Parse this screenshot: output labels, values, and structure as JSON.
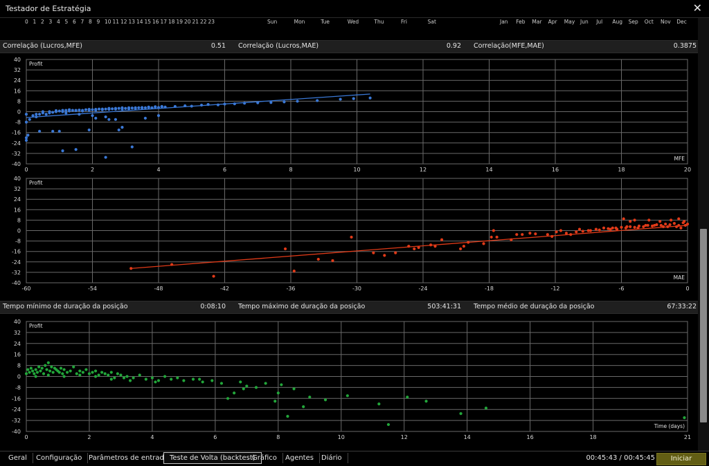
{
  "window": {
    "title": "Testador de Estratégia"
  },
  "hours": [
    "0",
    "1",
    "2",
    "3",
    "4",
    "5",
    "6",
    "7",
    "8",
    "9",
    "10",
    "11",
    "12",
    "13",
    "14",
    "15",
    "16",
    "17",
    "18",
    "19",
    "20",
    "21",
    "22",
    "23"
  ],
  "weekdays": [
    "Sun",
    "Mon",
    "Tue",
    "Wed",
    "Thu",
    "Fri",
    "Sat"
  ],
  "months": [
    "Jan",
    "Feb",
    "Mar",
    "Apr",
    "May",
    "Jun",
    "Jul",
    "Aug",
    "Sep",
    "Oct",
    "Nov",
    "Dec"
  ],
  "correlations": [
    {
      "label": "Correlação (Lucros,MFE)",
      "value": "0.51"
    },
    {
      "label": "Correlação (Lucros,MAE)",
      "value": "0.92"
    },
    {
      "label": "Correlação(MFE,MAE)",
      "value": "0.3875"
    }
  ],
  "durations": [
    {
      "label": "Tempo mínimo de duração da posição",
      "value": "0:08:10"
    },
    {
      "label": "Tempo máximo de duração da posição",
      "value": "503:41:31"
    },
    {
      "label": "Tempo médio de duração da posição",
      "value": "67:33:22"
    }
  ],
  "chart_data": [
    {
      "type": "scatter",
      "ylabel": "Profit",
      "xlabel": "MFE",
      "xlim": [
        0,
        20
      ],
      "ylim": [
        -40,
        40
      ],
      "xticks": [
        0,
        2,
        4,
        6,
        8,
        10,
        12,
        14,
        16,
        18,
        20
      ],
      "yticks": [
        40,
        32,
        24,
        16,
        8,
        0,
        -8,
        -16,
        -24,
        -32,
        -40
      ],
      "grid": true,
      "color": "#3a78d6",
      "trend": [
        [
          0,
          -4.5
        ],
        [
          10.4,
          13.5
        ]
      ],
      "points": [
        [
          0,
          -22
        ],
        [
          0,
          -20
        ],
        [
          0.05,
          -18
        ],
        [
          0,
          -8
        ],
        [
          0.1,
          -6
        ],
        [
          0,
          -2
        ],
        [
          0.2,
          -3
        ],
        [
          0.3,
          -4
        ],
        [
          0.4,
          -2
        ],
        [
          0.5,
          -1
        ],
        [
          0.6,
          -2
        ],
        [
          0.7,
          -1
        ],
        [
          0.8,
          -0.5
        ],
        [
          0.9,
          0
        ],
        [
          1,
          0.5
        ],
        [
          1.1,
          0
        ],
        [
          1.2,
          1
        ],
        [
          1.3,
          0.5
        ],
        [
          1.4,
          1
        ],
        [
          1.5,
          0.8
        ],
        [
          1.6,
          1.2
        ],
        [
          1.7,
          0.5
        ],
        [
          1.8,
          1.5
        ],
        [
          1.9,
          1
        ],
        [
          2,
          1.5
        ],
        [
          2.1,
          1
        ],
        [
          2.2,
          2
        ],
        [
          2.3,
          1.5
        ],
        [
          2.4,
          2
        ],
        [
          2.5,
          1.8
        ],
        [
          2.6,
          2.2
        ],
        [
          2.7,
          2
        ],
        [
          2.8,
          2.5
        ],
        [
          2.9,
          2
        ],
        [
          3,
          2.5
        ],
        [
          3.1,
          2.2
        ],
        [
          3.2,
          2.8
        ],
        [
          3.3,
          2.5
        ],
        [
          3.4,
          3
        ],
        [
          3.5,
          2.8
        ],
        [
          3.6,
          3
        ],
        [
          3.7,
          3.2
        ],
        [
          3.8,
          3
        ],
        [
          3.9,
          3.5
        ],
        [
          4,
          3.2
        ],
        [
          4.1,
          3.8
        ],
        [
          4.2,
          3.5
        ],
        [
          0.3,
          -2
        ],
        [
          0.5,
          0
        ],
        [
          0.7,
          0
        ],
        [
          0.9,
          0.8
        ],
        [
          1.1,
          1
        ],
        [
          1.3,
          1.5
        ],
        [
          1.5,
          1
        ],
        [
          1.7,
          1
        ],
        [
          1.9,
          1.8
        ],
        [
          2.1,
          1.8
        ],
        [
          2.3,
          2
        ],
        [
          2.5,
          2.5
        ],
        [
          2.7,
          2.5
        ],
        [
          2.9,
          3
        ],
        [
          3.1,
          3
        ],
        [
          3.3,
          3
        ],
        [
          3.5,
          3.2
        ],
        [
          3.7,
          3.5
        ],
        [
          3.9,
          3.8
        ],
        [
          4.1,
          4
        ],
        [
          1.2,
          -1
        ],
        [
          1.6,
          -2
        ],
        [
          2,
          -3
        ],
        [
          2.4,
          -4
        ],
        [
          2.5,
          -6
        ],
        [
          2.7,
          -6
        ],
        [
          2.1,
          -5
        ],
        [
          0.4,
          -15
        ],
        [
          0.8,
          -15
        ],
        [
          1,
          -15
        ],
        [
          1.9,
          -14
        ],
        [
          2.9,
          -12
        ],
        [
          2.8,
          -14
        ],
        [
          3.6,
          -5
        ],
        [
          4,
          -3
        ],
        [
          1.1,
          -30
        ],
        [
          1.5,
          -29
        ],
        [
          2.4,
          -35
        ],
        [
          3.2,
          -27
        ],
        [
          4.5,
          4
        ],
        [
          4.8,
          4.5
        ],
        [
          5,
          4.2
        ],
        [
          5.3,
          5
        ],
        [
          5.5,
          5.5
        ],
        [
          5.8,
          5.2
        ],
        [
          6,
          5.8
        ],
        [
          6.3,
          6
        ],
        [
          6.6,
          6.5
        ],
        [
          7,
          6.8
        ],
        [
          7.4,
          7
        ],
        [
          7.8,
          7.5
        ],
        [
          8.2,
          8
        ],
        [
          8.8,
          8.5
        ],
        [
          9.5,
          9.5
        ],
        [
          9.9,
          10
        ],
        [
          10.4,
          10.5
        ]
      ]
    },
    {
      "type": "scatter",
      "ylabel": "Profit",
      "xlabel": "MAE",
      "xlim": [
        -60,
        0
      ],
      "ylim": [
        -40,
        40
      ],
      "xticks": [
        -60,
        -54,
        -48,
        -42,
        -36,
        -30,
        -24,
        -18,
        -12,
        -6,
        0
      ],
      "yticks": [
        40,
        32,
        24,
        16,
        8,
        0,
        -8,
        -16,
        -24,
        -32,
        -40
      ],
      "grid": true,
      "color": "#e03a18",
      "trend": [
        [
          -50.5,
          -29
        ],
        [
          0,
          4
        ]
      ],
      "points": [
        [
          -50.5,
          -29
        ],
        [
          -46.8,
          -26
        ],
        [
          -43,
          -35
        ],
        [
          -36.5,
          -14
        ],
        [
          -35.7,
          -31
        ],
        [
          -33.5,
          -22
        ],
        [
          -32.2,
          -23
        ],
        [
          -30.5,
          -5
        ],
        [
          -28.5,
          -17
        ],
        [
          -27.5,
          -19
        ],
        [
          -26.5,
          -17
        ],
        [
          -25.3,
          -12
        ],
        [
          -24.8,
          -14
        ],
        [
          -24.4,
          -13
        ],
        [
          -23.3,
          -11
        ],
        [
          -22.9,
          -12
        ],
        [
          -22.3,
          -7
        ],
        [
          -20.6,
          -14
        ],
        [
          -20.3,
          -12
        ],
        [
          -19.9,
          -9
        ],
        [
          -18.5,
          -10
        ],
        [
          -17.8,
          -5
        ],
        [
          -17.6,
          0
        ],
        [
          -17.3,
          -5
        ],
        [
          -16,
          -7
        ],
        [
          -15.5,
          -3
        ],
        [
          -15,
          -3
        ],
        [
          -14.3,
          -2
        ],
        [
          -13.8,
          -2.5
        ],
        [
          -12.7,
          -3
        ],
        [
          -12.3,
          -4.5
        ],
        [
          -11.9,
          -1
        ],
        [
          -11.5,
          0
        ],
        [
          -11,
          -2
        ],
        [
          -10.6,
          -3
        ],
        [
          -10.1,
          -1
        ],
        [
          -9.8,
          1
        ],
        [
          -9.5,
          -0.5
        ],
        [
          -8.8,
          0
        ],
        [
          -8.3,
          1
        ],
        [
          -7.6,
          2
        ],
        [
          -7.2,
          1.5
        ],
        [
          -6.8,
          2
        ],
        [
          -6.4,
          1
        ],
        [
          -6,
          2.5
        ],
        [
          -5.6,
          2
        ],
        [
          -5.2,
          3
        ],
        [
          -4.8,
          2.5
        ],
        [
          -4.4,
          3.5
        ],
        [
          -4,
          3
        ],
        [
          -3.6,
          4
        ],
        [
          -3.2,
          3.5
        ],
        [
          -2.8,
          4.5
        ],
        [
          -2.4,
          4
        ],
        [
          -2,
          5
        ],
        [
          -1.6,
          4.5
        ],
        [
          -1.2,
          5.5
        ],
        [
          -0.8,
          4
        ],
        [
          -0.4,
          6
        ],
        [
          0,
          5
        ],
        [
          -5.8,
          9
        ],
        [
          -5.2,
          7
        ],
        [
          -4.8,
          8
        ],
        [
          -3.5,
          8
        ],
        [
          -2.5,
          7
        ],
        [
          -1.5,
          8
        ],
        [
          -0.8,
          9
        ],
        [
          -0.3,
          7
        ],
        [
          -9,
          0
        ],
        [
          -8,
          0.5
        ],
        [
          -7,
          1
        ],
        [
          -6.5,
          2
        ],
        [
          -5.5,
          3
        ],
        [
          -4.5,
          2
        ],
        [
          -3.8,
          4
        ],
        [
          -3,
          4
        ],
        [
          -2.2,
          3
        ],
        [
          -1.8,
          3
        ],
        [
          -1,
          3
        ],
        [
          -0.6,
          2
        ],
        [
          -0.2,
          4
        ]
      ]
    },
    {
      "type": "scatter",
      "ylabel": "Profit",
      "xlabel": "Time (days)",
      "xlim": [
        0,
        21
      ],
      "ylim": [
        -40,
        40
      ],
      "xticks": [
        0,
        2,
        4,
        6,
        8,
        10,
        12,
        14,
        16,
        18,
        21
      ],
      "yticks": [
        40,
        32,
        24,
        16,
        8,
        0,
        -8,
        -16,
        -24,
        -32,
        -40
      ],
      "grid": true,
      "color": "#22a63a",
      "trend": null,
      "points": [
        [
          0,
          2
        ],
        [
          0.05,
          5
        ],
        [
          0.1,
          3
        ],
        [
          0.15,
          6
        ],
        [
          0.2,
          4
        ],
        [
          0.25,
          2
        ],
        [
          0.3,
          5
        ],
        [
          0.35,
          3
        ],
        [
          0.4,
          7
        ],
        [
          0.45,
          4
        ],
        [
          0.5,
          6
        ],
        [
          0.55,
          2
        ],
        [
          0.6,
          8
        ],
        [
          0.65,
          5
        ],
        [
          0.7,
          10
        ],
        [
          0.75,
          4
        ],
        [
          0.8,
          7
        ],
        [
          0.85,
          3
        ],
        [
          0.9,
          6
        ],
        [
          0.95,
          5
        ],
        [
          1,
          4
        ],
        [
          1.05,
          3
        ],
        [
          1.1,
          6
        ],
        [
          1.15,
          2
        ],
        [
          1.2,
          5
        ],
        [
          1.3,
          3
        ],
        [
          1.4,
          4
        ],
        [
          1.5,
          7
        ],
        [
          1.6,
          2
        ],
        [
          1.7,
          4
        ],
        [
          1.8,
          3
        ],
        [
          1.9,
          5
        ],
        [
          2,
          2
        ],
        [
          2.1,
          3
        ],
        [
          2.2,
          4
        ],
        [
          2.3,
          1
        ],
        [
          2.4,
          3
        ],
        [
          2.5,
          2
        ],
        [
          2.6,
          1
        ],
        [
          2.7,
          3
        ],
        [
          2.8,
          -1
        ],
        [
          2.9,
          2
        ],
        [
          3,
          1
        ],
        [
          3.1,
          -1
        ],
        [
          3.2,
          0
        ],
        [
          3.4,
          -1
        ],
        [
          3.6,
          1
        ],
        [
          3.8,
          -2
        ],
        [
          4,
          -1
        ],
        [
          4.2,
          -3
        ],
        [
          4.4,
          0
        ],
        [
          4.6,
          -2
        ],
        [
          4.8,
          -1
        ],
        [
          5,
          -3
        ],
        [
          5.3,
          -2
        ],
        [
          5.6,
          -4
        ],
        [
          5.9,
          -3
        ],
        [
          6.2,
          -5
        ],
        [
          6.4,
          -16
        ],
        [
          6.6,
          -12
        ],
        [
          6.8,
          -4
        ],
        [
          7,
          -7
        ],
        [
          7.3,
          -8
        ],
        [
          7.6,
          -5
        ],
        [
          7.9,
          -18
        ],
        [
          8.1,
          -6
        ],
        [
          8.3,
          -29
        ],
        [
          8.5,
          -9
        ],
        [
          8.8,
          -22
        ],
        [
          9,
          -15
        ],
        [
          9.5,
          -17
        ],
        [
          10.2,
          -14
        ],
        [
          11.2,
          -20
        ],
        [
          11.5,
          -35
        ],
        [
          12.1,
          -15
        ],
        [
          12.7,
          -18
        ],
        [
          13.8,
          -27
        ],
        [
          14.6,
          -23
        ],
        [
          20.9,
          -30
        ],
        [
          0.3,
          0
        ],
        [
          0.7,
          1
        ],
        [
          1.2,
          0
        ],
        [
          1.7,
          1
        ],
        [
          2.2,
          0
        ],
        [
          2.7,
          -2
        ],
        [
          3.3,
          -3
        ],
        [
          4.1,
          -4
        ],
        [
          5.5,
          -2
        ],
        [
          6.9,
          -9
        ],
        [
          8,
          -12
        ]
      ]
    }
  ],
  "tabs": [
    "Geral",
    "Configuração",
    "Parâmetros de entrada",
    "Teste de Volta (backtest)",
    "Gráfico",
    "Agentes",
    "Diário"
  ],
  "time_info": "00:45:43 / 00:45:45",
  "start_button": "Iniciar"
}
